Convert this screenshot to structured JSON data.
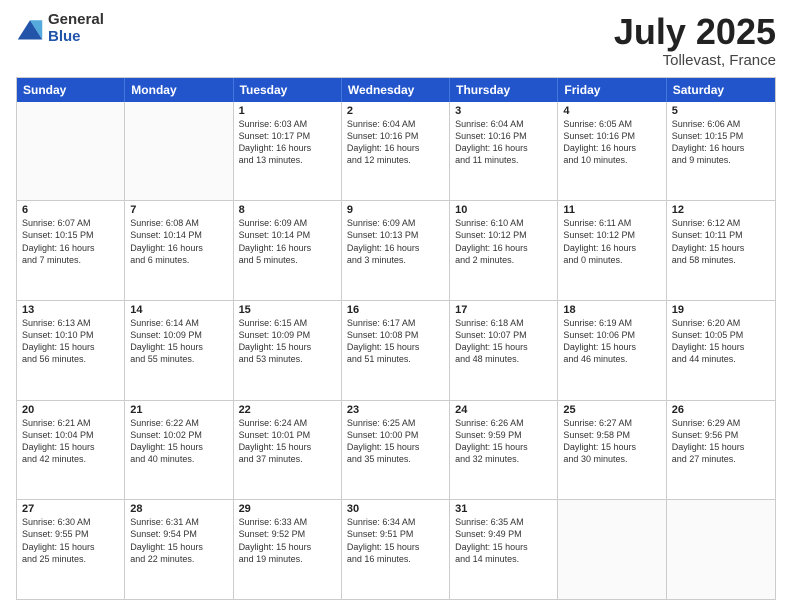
{
  "logo": {
    "general": "General",
    "blue": "Blue"
  },
  "title": {
    "month": "July 2025",
    "location": "Tollevast, France"
  },
  "header": {
    "days": [
      "Sunday",
      "Monday",
      "Tuesday",
      "Wednesday",
      "Thursday",
      "Friday",
      "Saturday"
    ]
  },
  "weeks": [
    [
      {
        "day": "",
        "info": ""
      },
      {
        "day": "",
        "info": ""
      },
      {
        "day": "1",
        "info": "Sunrise: 6:03 AM\nSunset: 10:17 PM\nDaylight: 16 hours\nand 13 minutes."
      },
      {
        "day": "2",
        "info": "Sunrise: 6:04 AM\nSunset: 10:16 PM\nDaylight: 16 hours\nand 12 minutes."
      },
      {
        "day": "3",
        "info": "Sunrise: 6:04 AM\nSunset: 10:16 PM\nDaylight: 16 hours\nand 11 minutes."
      },
      {
        "day": "4",
        "info": "Sunrise: 6:05 AM\nSunset: 10:16 PM\nDaylight: 16 hours\nand 10 minutes."
      },
      {
        "day": "5",
        "info": "Sunrise: 6:06 AM\nSunset: 10:15 PM\nDaylight: 16 hours\nand 9 minutes."
      }
    ],
    [
      {
        "day": "6",
        "info": "Sunrise: 6:07 AM\nSunset: 10:15 PM\nDaylight: 16 hours\nand 7 minutes."
      },
      {
        "day": "7",
        "info": "Sunrise: 6:08 AM\nSunset: 10:14 PM\nDaylight: 16 hours\nand 6 minutes."
      },
      {
        "day": "8",
        "info": "Sunrise: 6:09 AM\nSunset: 10:14 PM\nDaylight: 16 hours\nand 5 minutes."
      },
      {
        "day": "9",
        "info": "Sunrise: 6:09 AM\nSunset: 10:13 PM\nDaylight: 16 hours\nand 3 minutes."
      },
      {
        "day": "10",
        "info": "Sunrise: 6:10 AM\nSunset: 10:12 PM\nDaylight: 16 hours\nand 2 minutes."
      },
      {
        "day": "11",
        "info": "Sunrise: 6:11 AM\nSunset: 10:12 PM\nDaylight: 16 hours\nand 0 minutes."
      },
      {
        "day": "12",
        "info": "Sunrise: 6:12 AM\nSunset: 10:11 PM\nDaylight: 15 hours\nand 58 minutes."
      }
    ],
    [
      {
        "day": "13",
        "info": "Sunrise: 6:13 AM\nSunset: 10:10 PM\nDaylight: 15 hours\nand 56 minutes."
      },
      {
        "day": "14",
        "info": "Sunrise: 6:14 AM\nSunset: 10:09 PM\nDaylight: 15 hours\nand 55 minutes."
      },
      {
        "day": "15",
        "info": "Sunrise: 6:15 AM\nSunset: 10:09 PM\nDaylight: 15 hours\nand 53 minutes."
      },
      {
        "day": "16",
        "info": "Sunrise: 6:17 AM\nSunset: 10:08 PM\nDaylight: 15 hours\nand 51 minutes."
      },
      {
        "day": "17",
        "info": "Sunrise: 6:18 AM\nSunset: 10:07 PM\nDaylight: 15 hours\nand 48 minutes."
      },
      {
        "day": "18",
        "info": "Sunrise: 6:19 AM\nSunset: 10:06 PM\nDaylight: 15 hours\nand 46 minutes."
      },
      {
        "day": "19",
        "info": "Sunrise: 6:20 AM\nSunset: 10:05 PM\nDaylight: 15 hours\nand 44 minutes."
      }
    ],
    [
      {
        "day": "20",
        "info": "Sunrise: 6:21 AM\nSunset: 10:04 PM\nDaylight: 15 hours\nand 42 minutes."
      },
      {
        "day": "21",
        "info": "Sunrise: 6:22 AM\nSunset: 10:02 PM\nDaylight: 15 hours\nand 40 minutes."
      },
      {
        "day": "22",
        "info": "Sunrise: 6:24 AM\nSunset: 10:01 PM\nDaylight: 15 hours\nand 37 minutes."
      },
      {
        "day": "23",
        "info": "Sunrise: 6:25 AM\nSunset: 10:00 PM\nDaylight: 15 hours\nand 35 minutes."
      },
      {
        "day": "24",
        "info": "Sunrise: 6:26 AM\nSunset: 9:59 PM\nDaylight: 15 hours\nand 32 minutes."
      },
      {
        "day": "25",
        "info": "Sunrise: 6:27 AM\nSunset: 9:58 PM\nDaylight: 15 hours\nand 30 minutes."
      },
      {
        "day": "26",
        "info": "Sunrise: 6:29 AM\nSunset: 9:56 PM\nDaylight: 15 hours\nand 27 minutes."
      }
    ],
    [
      {
        "day": "27",
        "info": "Sunrise: 6:30 AM\nSunset: 9:55 PM\nDaylight: 15 hours\nand 25 minutes."
      },
      {
        "day": "28",
        "info": "Sunrise: 6:31 AM\nSunset: 9:54 PM\nDaylight: 15 hours\nand 22 minutes."
      },
      {
        "day": "29",
        "info": "Sunrise: 6:33 AM\nSunset: 9:52 PM\nDaylight: 15 hours\nand 19 minutes."
      },
      {
        "day": "30",
        "info": "Sunrise: 6:34 AM\nSunset: 9:51 PM\nDaylight: 15 hours\nand 16 minutes."
      },
      {
        "day": "31",
        "info": "Sunrise: 6:35 AM\nSunset: 9:49 PM\nDaylight: 15 hours\nand 14 minutes."
      },
      {
        "day": "",
        "info": ""
      },
      {
        "day": "",
        "info": ""
      }
    ]
  ]
}
